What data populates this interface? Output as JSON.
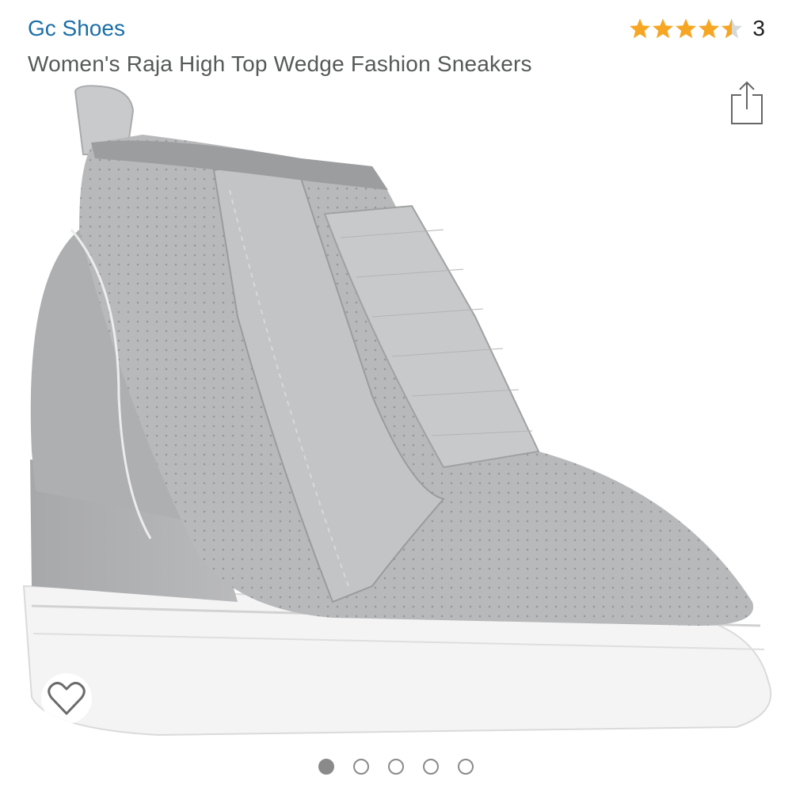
{
  "product": {
    "brand": "Gc Shoes",
    "title": "Women's Raja High Top Wedge Fashion Sneakers"
  },
  "rating": {
    "stars": 4.5,
    "max_stars": 5,
    "count": "3",
    "star_color": "#f6a623",
    "empty_color": "#d5d9d9"
  },
  "icons": {
    "share": "share-icon",
    "favorite": "heart-icon"
  },
  "colors": {
    "brand_link": "#1a6fa8",
    "title_text": "#565959",
    "shoe_upper": "#b8b9bb",
    "sole": "#f4f4f4"
  },
  "carousel": {
    "total": 5,
    "active": 1
  }
}
